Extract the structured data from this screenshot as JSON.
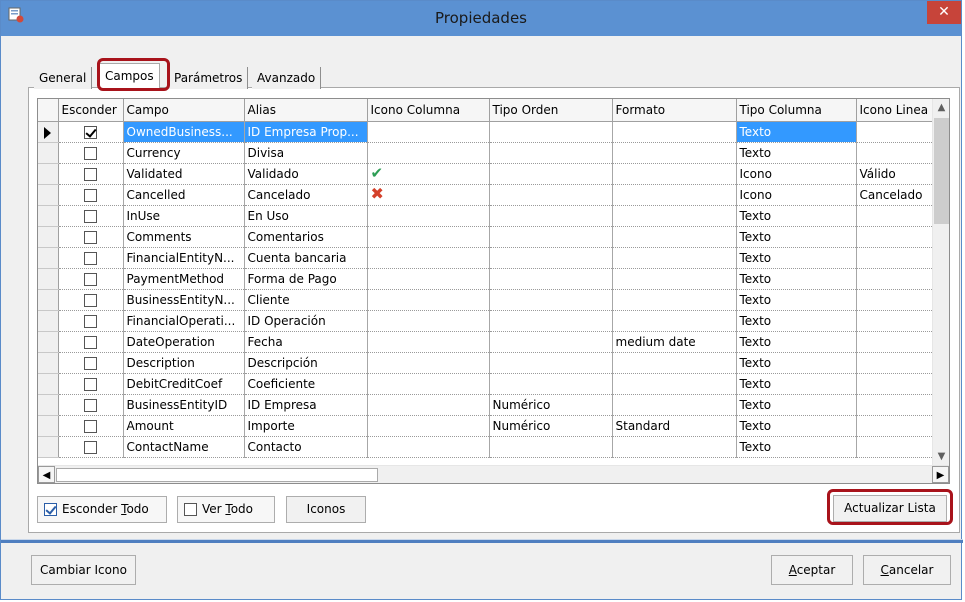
{
  "window": {
    "title": "Propiedades",
    "close_glyph": "✕",
    "app_icon": "properties-icon"
  },
  "tabs": [
    {
      "label": "General"
    },
    {
      "label": "Campos",
      "active": true
    },
    {
      "label": "Parámetros"
    },
    {
      "label": "Avanzado"
    }
  ],
  "grid": {
    "columns": [
      "",
      "Esconder",
      "Campo",
      "Alias",
      "Icono Columna",
      "Tipo Orden",
      "Formato",
      "Tipo Columna",
      "Icono Linea"
    ],
    "rows": [
      {
        "hide": true,
        "campo": "OwnedBusiness...",
        "alias": "ID Empresa Prop...",
        "icono_columna": "",
        "tipo_orden": "",
        "formato": "",
        "tipo_columna": "Texto",
        "icono_linea": "",
        "selected": true
      },
      {
        "hide": false,
        "campo": "Currency",
        "alias": "Divisa",
        "icono_columna": "",
        "tipo_orden": "",
        "formato": "",
        "tipo_columna": "Texto",
        "icono_linea": ""
      },
      {
        "hide": false,
        "campo": "Validated",
        "alias": "Validado",
        "icono_columna": "check",
        "tipo_orden": "",
        "formato": "",
        "tipo_columna": "Icono",
        "icono_linea": "Válido"
      },
      {
        "hide": false,
        "campo": "Cancelled",
        "alias": "Cancelado",
        "icono_columna": "x",
        "tipo_orden": "",
        "formato": "",
        "tipo_columna": "Icono",
        "icono_linea": "Cancelado"
      },
      {
        "hide": false,
        "campo": "InUse",
        "alias": "En Uso",
        "icono_columna": "",
        "tipo_orden": "",
        "formato": "",
        "tipo_columna": "Texto",
        "icono_linea": ""
      },
      {
        "hide": false,
        "campo": "Comments",
        "alias": "Comentarios",
        "icono_columna": "",
        "tipo_orden": "",
        "formato": "",
        "tipo_columna": "Texto",
        "icono_linea": ""
      },
      {
        "hide": false,
        "campo": "FinancialEntityN...",
        "alias": "Cuenta bancaria",
        "icono_columna": "",
        "tipo_orden": "",
        "formato": "",
        "tipo_columna": "Texto",
        "icono_linea": ""
      },
      {
        "hide": false,
        "campo": "PaymentMethod",
        "alias": "Forma de Pago",
        "icono_columna": "",
        "tipo_orden": "",
        "formato": "",
        "tipo_columna": "Texto",
        "icono_linea": ""
      },
      {
        "hide": false,
        "campo": "BusinessEntityN...",
        "alias": "Cliente",
        "icono_columna": "",
        "tipo_orden": "",
        "formato": "",
        "tipo_columna": "Texto",
        "icono_linea": ""
      },
      {
        "hide": false,
        "campo": "FinancialOperati...",
        "alias": "ID Operación",
        "icono_columna": "",
        "tipo_orden": "",
        "formato": "",
        "tipo_columna": "Texto",
        "icono_linea": ""
      },
      {
        "hide": false,
        "campo": "DateOperation",
        "alias": "Fecha",
        "icono_columna": "",
        "tipo_orden": "",
        "formato": "medium date",
        "tipo_columna": "Texto",
        "icono_linea": ""
      },
      {
        "hide": false,
        "campo": "Description",
        "alias": "Descripción",
        "icono_columna": "",
        "tipo_orden": "",
        "formato": "",
        "tipo_columna": "Texto",
        "icono_linea": ""
      },
      {
        "hide": false,
        "campo": "DebitCreditCoef",
        "alias": "Coeficiente",
        "icono_columna": "",
        "tipo_orden": "",
        "formato": "",
        "tipo_columna": "Texto",
        "icono_linea": ""
      },
      {
        "hide": false,
        "campo": "BusinessEntityID",
        "alias": "ID Empresa",
        "icono_columna": "",
        "tipo_orden": "Numérico",
        "formato": "",
        "tipo_columna": "Texto",
        "icono_linea": ""
      },
      {
        "hide": false,
        "campo": "Amount",
        "alias": "Importe",
        "icono_columna": "",
        "tipo_orden": "Numérico",
        "formato": "Standard",
        "tipo_columna": "Texto",
        "icono_linea": ""
      },
      {
        "hide": false,
        "campo": "ContactName",
        "alias": "Contacto",
        "icono_columna": "",
        "tipo_orden": "",
        "formato": "",
        "tipo_columna": "Texto",
        "icono_linea": ""
      }
    ]
  },
  "buttons": {
    "hide_all": {
      "label_pre": "Esconder ",
      "label_ul": "T",
      "label_post": "odo",
      "checked": true
    },
    "show_all": {
      "label_pre": "Ver ",
      "label_ul": "T",
      "label_post": "odo",
      "checked": false
    },
    "icons": "Iconos",
    "update_list": "Actualizar Lista",
    "change_icon": "Cambiar Icono",
    "accept": {
      "label_ul": "A",
      "label_post": "ceptar"
    },
    "cancel": {
      "label_ul": "C",
      "label_post": "ancelar"
    }
  },
  "colors": {
    "titlebar": "#5b91d2",
    "selection": "#3399ff",
    "highlight_border": "#a8131b",
    "close": "#c7443a"
  }
}
